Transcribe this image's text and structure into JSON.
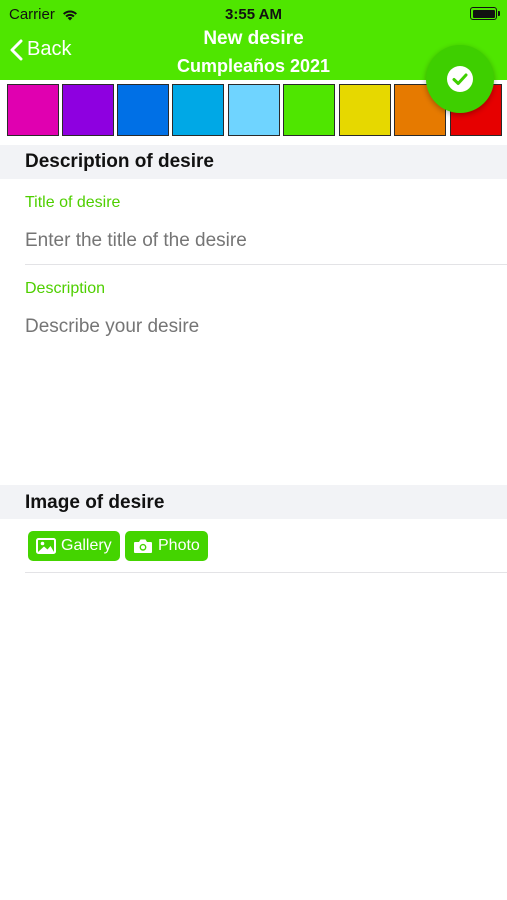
{
  "status": {
    "carrier": "Carrier",
    "time": "3:55 AM"
  },
  "nav": {
    "back_label": "Back",
    "title": "New desire",
    "subtitle": "Cumpleaños 2021"
  },
  "colors": {
    "header": "#4fe600",
    "swatches": [
      "#e000b0",
      "#8e00e0",
      "#0070e6",
      "#00a8e6",
      "#6fd4ff",
      "#4fe600",
      "#e6d800",
      "#e67a00",
      "#e60000"
    ]
  },
  "description_section": {
    "heading": "Description of desire",
    "title_label": "Title of desire",
    "title_placeholder": "Enter the title of the desire",
    "description_label": "Description",
    "description_placeholder": "Describe your desire"
  },
  "image_section": {
    "heading": "Image of desire",
    "gallery_label": "Gallery",
    "photo_label": "Photo"
  },
  "icons": [
    "wifi-icon",
    "battery-icon",
    "chevron-left-icon",
    "checkmark-icon",
    "image-icon",
    "camera-icon"
  ]
}
